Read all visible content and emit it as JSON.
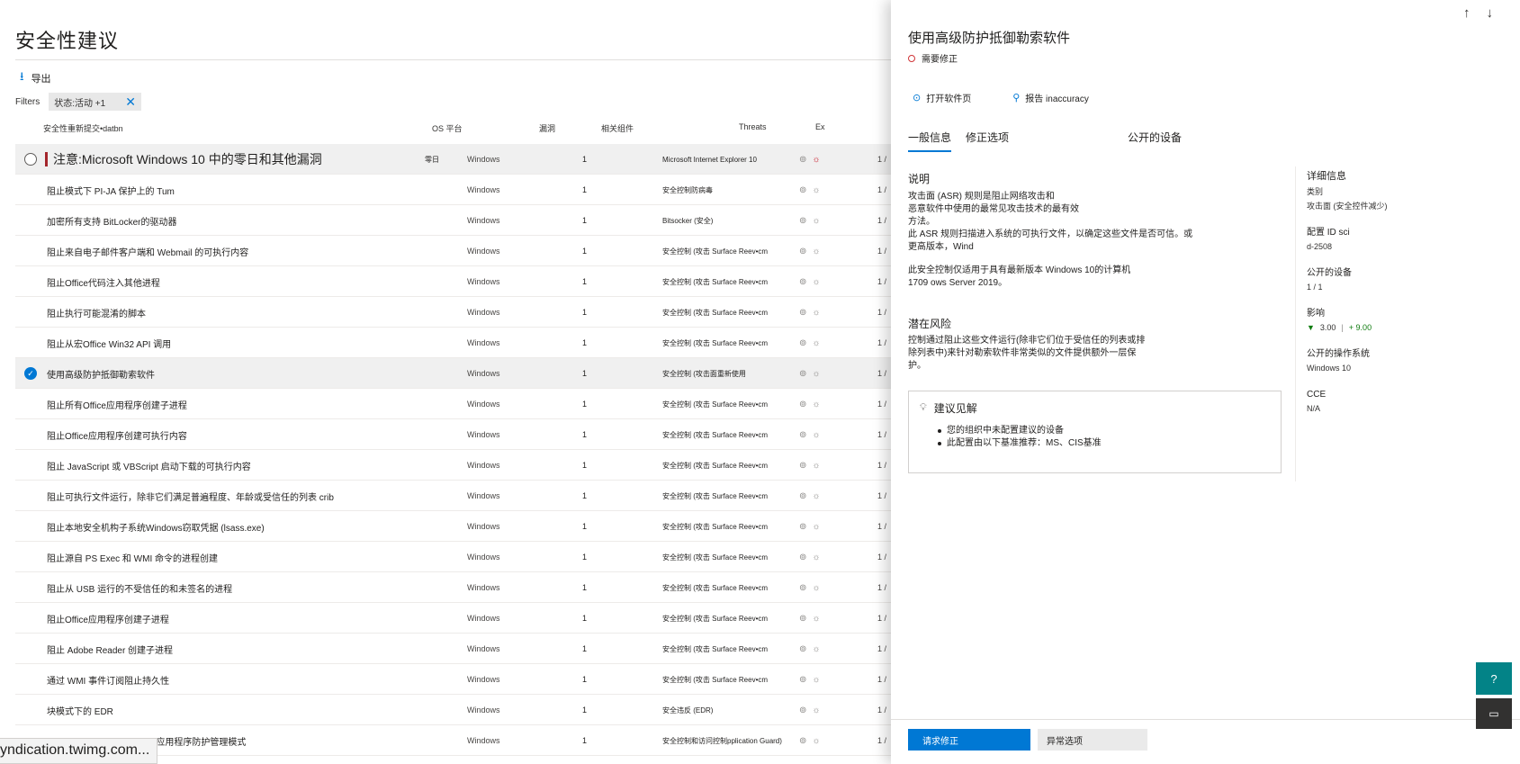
{
  "page": {
    "title": "安全性建议"
  },
  "toolbar": {
    "export_label": "导出"
  },
  "filters": {
    "label": "Filters",
    "pill_text": "状态:活动 +1"
  },
  "table": {
    "headers": {
      "name": "安全性重新提交•datbn",
      "os": "OS 平台",
      "exposure": "漏洞",
      "component": "相关组件",
      "threats": "Threats",
      "extra": "Ex"
    },
    "rows": [
      {
        "name": "注意:Microsoft Windows 10 中的零日和其他漏洞",
        "tag": "零日",
        "os": "Windows",
        "exp": "1",
        "comp": "Microsoft Internet Explorer 10",
        "extra": "1 /"
      },
      {
        "name": "阻止模式下 PI-JA 保护上的 Tum",
        "os": "Windows",
        "exp": "1",
        "comp": "安全控制防病毒",
        "extra": "1 /"
      },
      {
        "name": "加密所有支持 BitLocker的驱动器",
        "os": "Windows",
        "exp": "1",
        "comp": "Bitsocker (安全)",
        "extra": "1 /"
      },
      {
        "name": "阻止来自电子邮件客户端和 Webmail 的可执行内容",
        "os": "Windows",
        "exp": "1",
        "comp": "安全控制 (攻击 Surface Reev•cm",
        "extra": "1 /"
      },
      {
        "name": "阻止Office代码注入其他进程",
        "os": "Windows",
        "exp": "1",
        "comp": "安全控制 (攻击 Surface Reev•cm",
        "extra": "1 /"
      },
      {
        "name": "阻止执行可能混淆的脚本",
        "os": "Windows",
        "exp": "1",
        "comp": "安全控制 (攻击 Surface Reev•cm",
        "extra": "1 /"
      },
      {
        "name": "阻止从宏Office Win32 API 调用",
        "os": "Windows",
        "exp": "1",
        "comp": "安全控制 (攻击 Surface Reev•cm",
        "extra": "1 /"
      },
      {
        "name": "使用高级防护抵御勒索软件",
        "os": "Windows",
        "exp": "1",
        "comp": "安全控制 (攻击面重新使用",
        "extra": "1 /"
      },
      {
        "name": "阻止所有Office应用程序创建子进程",
        "os": "Windows",
        "exp": "1",
        "comp": "安全控制 (攻击 Surface Reev•cm",
        "extra": "1 /"
      },
      {
        "name": "阻止Office应用程序创建可执行内容",
        "os": "Windows",
        "exp": "1",
        "comp": "安全控制 (攻击 Surface Reev•cm",
        "extra": "1 /"
      },
      {
        "name": "阻止 JavaScript 或 VBScript 启动下载的可执行内容",
        "os": "Windows",
        "exp": "1",
        "comp": "安全控制 (攻击 Surface Reev•cm",
        "extra": "1 /"
      },
      {
        "name": "阻止可执行文件运行，除非它们满足普遍程度、年龄或受信任的列表 crib",
        "os": "Windows",
        "exp": "1",
        "comp": "安全控制 (攻击 Surface Reev•cm",
        "extra": "1 /"
      },
      {
        "name": "阻止本地安全机构子系统Windows窃取凭据 (lsass.exe)",
        "os": "Windows",
        "exp": "1",
        "comp": "安全控制 (攻击 Surface Reev•cm",
        "extra": "1 /"
      },
      {
        "name": "阻止源自 PS Exec 和 WMI 命令的进程创建",
        "os": "Windows",
        "exp": "1",
        "comp": "安全控制 (攻击 Surface Reev•cm",
        "extra": "1 /"
      },
      {
        "name": "阻止从 USB 运行的不受信任的和未签名的进程",
        "os": "Windows",
        "exp": "1",
        "comp": "安全控制 (攻击 Surface Reev•cm",
        "extra": "1 /"
      },
      {
        "name": "阻止Office应用程序创建子进程",
        "os": "Windows",
        "exp": "1",
        "comp": "安全控制 (攻击 Surface Reev•cm",
        "extra": "1 /"
      },
      {
        "name": "阻止 Adobe Reader 创建子进程",
        "os": "Windows",
        "exp": "1",
        "comp": "安全控制 (攻击 Surface Reev•cm",
        "extra": "1 /"
      },
      {
        "name": "通过 WMI 事件订阅阻止持久性",
        "os": "Windows",
        "exp": "1",
        "comp": "安全控制 (攻击 Surface Reev•cm",
        "extra": "1 /"
      },
      {
        "name": "块模式下的 EDR",
        "os": "Windows",
        "exp": "1",
        "comp": "安全违反 (EDR)",
        "extra": "1 /"
      },
      {
        "name": "Turn on Microsoft Defender应用程序防护管理模式",
        "os": "Windows",
        "exp": "1",
        "comp": "安全控制和访问控制pplication Guard)",
        "extra": "1 /"
      }
    ]
  },
  "status_url": "yndication.twimg.com...",
  "panel": {
    "title": "使用高级防护抵御勒索软件",
    "status": "需要修正",
    "actions": {
      "open_software": "打开软件页",
      "report": "报告 inaccuracy"
    },
    "tabs": [
      "一般信息",
      "修正选项",
      "公开的设备"
    ],
    "description_title": "说明",
    "description": [
      "攻击面 (ASR) 规则是阻止网络攻击和",
      "恶意软件中使用的最常见攻击技术的最有效",
      "方法。",
      "此 ASR 规则扫描进入系统的可执行文件，以确定这些文件是否可信。或",
      "更高版本，Wind",
      "",
      "此安全控制仅适用于具有最新版本 Windows 10的计算机",
      "1709 ows Server 2019。"
    ],
    "risk_title": "潜在风险",
    "risk_text": "控制通过阻止这些文件运行(除非它们位于受信任的列表或排除列表中)来针对勒索软件非常类似的文件提供额外一层保护。",
    "insight_title": "建议见解",
    "insights": [
      "您的组织中未配置建议的设备",
      "此配置由以下基准推荐：MS、CIS基准"
    ],
    "details": {
      "title": "详细信息",
      "category_label": "类别",
      "category_value": "攻击面 (安全控件减少)",
      "config_label": "配置 ID sci",
      "config_value": "d-2508",
      "devices_label": "公开的设备",
      "devices_value": "1 / 1",
      "impact_label": "影响",
      "impact_down": "3.00",
      "impact_up": "+ 9.00",
      "os_label": "公开的操作系统",
      "os_value": "Windows 10",
      "cce_label": "CCE",
      "cce_value": "N/A"
    },
    "buttons": {
      "primary": "请求修正",
      "secondary": "异常选项"
    }
  }
}
